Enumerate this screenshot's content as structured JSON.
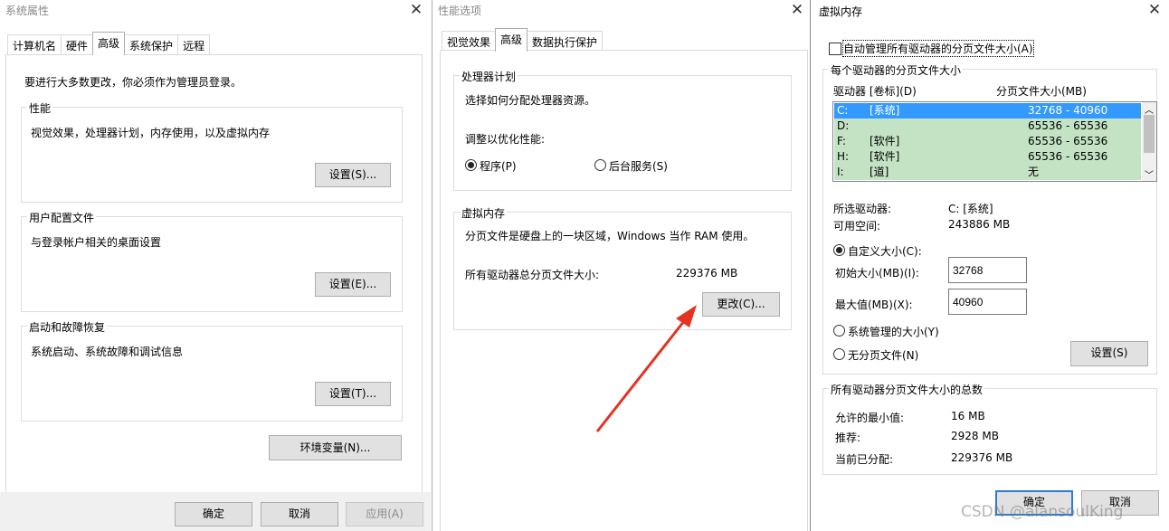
{
  "win1": {
    "title": "系统属性",
    "tabs": [
      "计算机名",
      "硬件",
      "高级",
      "系统保护",
      "远程"
    ],
    "notice": "要进行大多数更改，你必须作为管理员登录。",
    "perf": {
      "label": "性能",
      "desc": "视觉效果，处理器计划，内存使用，以及虚拟内存",
      "button": "设置(S)..."
    },
    "profile": {
      "label": "用户配置文件",
      "desc": "与登录帐户相关的桌面设置",
      "button": "设置(E)..."
    },
    "startup": {
      "label": "启动和故障恢复",
      "desc": "系统启动、系统故障和调试信息",
      "button": "设置(T)..."
    },
    "env_button": "环境变量(N)...",
    "ok": "确定",
    "cancel": "取消",
    "apply": "应用(A)"
  },
  "win2": {
    "title": "性能选项",
    "tabs": [
      "视觉效果",
      "高级",
      "数据执行保护"
    ],
    "cpu": {
      "label": "处理器计划",
      "desc": "选择如何分配处理器资源。",
      "adjust": "调整以优化性能:",
      "opt_programs": "程序(P)",
      "opt_services": "后台服务(S)"
    },
    "vm": {
      "label": "虚拟内存",
      "desc": "分页文件是硬盘上的一块区域，Windows 当作 RAM 使用。",
      "total_label": "所有驱动器总分页文件大小:",
      "total_value": "229376 MB",
      "change_button": "更改(C)..."
    }
  },
  "win3": {
    "title": "虚拟内存",
    "auto_manage": "自动管理所有驱动器的分页文件大小(A)",
    "per_drive_label": "每个驱动器的分页文件大小",
    "col_drive": "驱动器 [卷标](D)",
    "col_size": "分页文件大小(MB)",
    "drives": [
      {
        "drive": "C:",
        "label": "[系统]",
        "size": "32768 - 40960"
      },
      {
        "drive": "D:",
        "label": "",
        "size": "65536 - 65536"
      },
      {
        "drive": "F:",
        "label": "[软件]",
        "size": "65536 - 65536"
      },
      {
        "drive": "H:",
        "label": "[软件]",
        "size": "65536 - 65536"
      },
      {
        "drive": "I:",
        "label": "[道]",
        "size": "无"
      }
    ],
    "selected_label": "所选驱动器:",
    "selected_value": "C:  [系统]",
    "free_label": "可用空间:",
    "free_value": "243886 MB",
    "custom_size": "自定义大小(C):",
    "initial_label": "初始大小(MB)(I):",
    "initial_value": "32768",
    "max_label": "最大值(MB)(X):",
    "max_value": "40960",
    "system_managed": "系统管理的大小(Y)",
    "no_paging": "无分页文件(N)",
    "set_button": "设置(S)",
    "totals_label": "所有驱动器分页文件大小的总数",
    "min_label": "允许的最小值:",
    "min_value": "16 MB",
    "rec_label": "推荐:",
    "rec_value": "2928 MB",
    "cur_label": "当前已分配:",
    "cur_value": "229376 MB",
    "ok": "确定",
    "cancel": "取消"
  },
  "watermark": "CSDN @alansoulKing",
  "colors": {
    "accent": "#2e7bd6",
    "list_highlight": "#c4e3c4",
    "selection": "#3399ff",
    "arrow": "#e53222"
  }
}
